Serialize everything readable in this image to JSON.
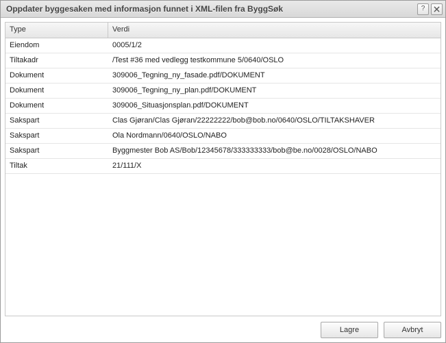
{
  "window": {
    "title": "Oppdater byggesaken med informasjon funnet i XML-filen fra ByggSøk"
  },
  "grid": {
    "columns": {
      "type": "Type",
      "value": "Verdi"
    },
    "rows": [
      {
        "type": "Eiendom",
        "value": "0005/1/2"
      },
      {
        "type": "Tiltakadr",
        "value": "/Test #36 med vedlegg testkommune 5/0640/OSLO"
      },
      {
        "type": "Dokument",
        "value": "309006_Tegning_ny_fasade.pdf/DOKUMENT"
      },
      {
        "type": "Dokument",
        "value": "309006_Tegning_ny_plan.pdf/DOKUMENT"
      },
      {
        "type": "Dokument",
        "value": "309006_Situasjonsplan.pdf/DOKUMENT"
      },
      {
        "type": "Sakspart",
        "value": "Clas Gjøran/Clas Gjøran/22222222/bob@bob.no/0640/OSLO/TILTAKSHAVER"
      },
      {
        "type": "Sakspart",
        "value": "Ola Nordmann/0640/OSLO/NABO"
      },
      {
        "type": "Sakspart",
        "value": "Byggmester Bob AS/Bob/12345678/333333333/bob@be.no/0028/OSLO/NABO"
      },
      {
        "type": "Tiltak",
        "value": "21/111/X"
      }
    ]
  },
  "buttons": {
    "save": "Lagre",
    "cancel": "Avbryt"
  }
}
